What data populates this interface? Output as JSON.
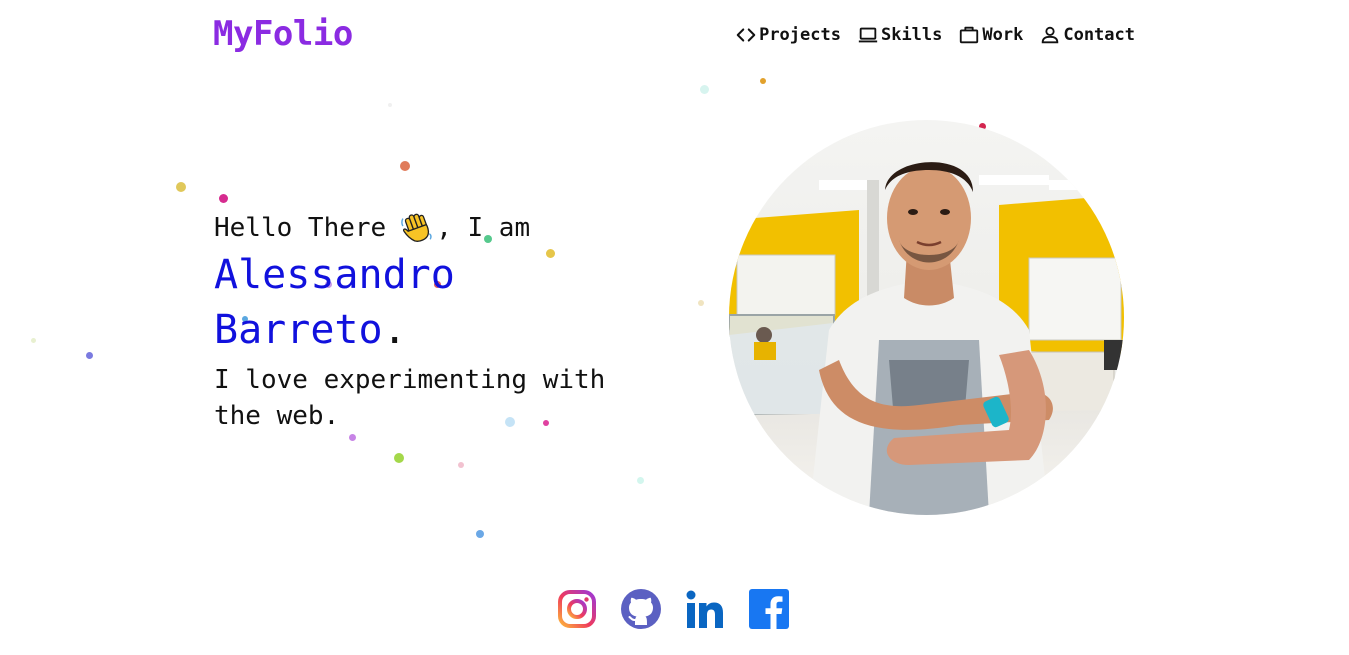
{
  "brand": {
    "logo_text": "MyFolio",
    "logo_color": "#8b2be2"
  },
  "nav": {
    "items": [
      {
        "label": "Projects",
        "icon": "code-icon"
      },
      {
        "label": "Skills",
        "icon": "laptop-icon"
      },
      {
        "label": "Work",
        "icon": "briefcase-icon"
      },
      {
        "label": "Contact",
        "icon": "user-icon"
      }
    ]
  },
  "hero": {
    "greeting_before": "Hello There",
    "greeting_after": ", I am",
    "wave_emoji": "waving-hand-icon",
    "name_line1": "Alessandro",
    "name_line2": "Barreto",
    "name_dot": ".",
    "name_color": "#1111dd",
    "tagline": "I love experimenting with the web."
  },
  "profile_photo": {
    "subject": "profile-photo"
  },
  "socials": [
    {
      "name": "instagram-icon"
    },
    {
      "name": "github-icon"
    },
    {
      "name": "linkedin-icon"
    },
    {
      "name": "facebook-icon"
    }
  ],
  "colors": {
    "accent_purple": "#8b2be2",
    "name_blue": "#1111dd",
    "github_purple": "#5b60c2",
    "linkedin_blue": "#0a66c2",
    "facebook_blue": "#1877f2"
  }
}
